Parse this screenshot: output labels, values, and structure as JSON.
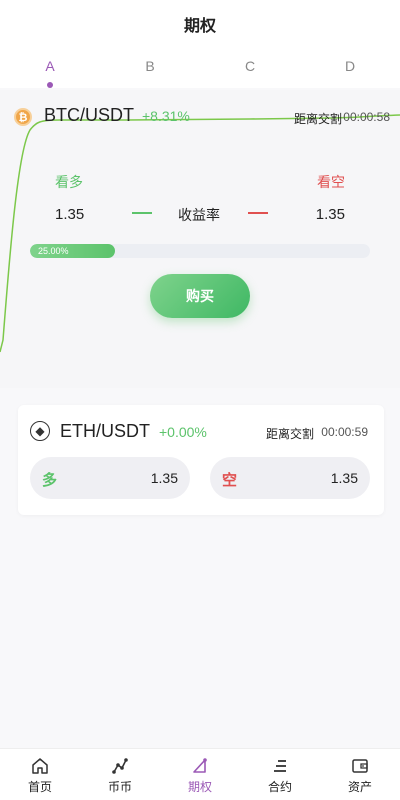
{
  "header": {
    "title": "期权"
  },
  "tabs": [
    {
      "label": "A",
      "active": true
    },
    {
      "label": "B",
      "active": false
    },
    {
      "label": "C",
      "active": false
    },
    {
      "label": "D",
      "active": false
    }
  ],
  "btc_card": {
    "symbol": "BTC/USDT",
    "change": "+8.31%",
    "countdown_label": "距离交割",
    "countdown": "00:00:58",
    "long_label": "看多",
    "short_label": "看空",
    "long_odds": "1.35",
    "short_odds": "1.35",
    "rate_label": "收益率",
    "progress_label": "25.00%",
    "progress_fraction": 0.25,
    "buy_label": "购买"
  },
  "eth_card": {
    "symbol": "ETH/USDT",
    "change": "+0.00%",
    "countdown_label": "距离交割",
    "countdown": "00:00:59",
    "long_word": "多",
    "long_odds": "1.35",
    "short_word": "空",
    "short_odds": "1.35"
  },
  "bottom_nav": [
    {
      "label": "首页",
      "icon": "home-icon",
      "active": false
    },
    {
      "label": "币币",
      "icon": "coin-trade-icon",
      "active": false
    },
    {
      "label": "期权",
      "icon": "options-icon",
      "active": true
    },
    {
      "label": "合约",
      "icon": "contract-icon",
      "active": false
    },
    {
      "label": "资产",
      "icon": "wallet-icon",
      "active": false
    }
  ],
  "colors": {
    "accent": "#9b59b6",
    "up": "#5cc36b",
    "down": "#e05050"
  }
}
